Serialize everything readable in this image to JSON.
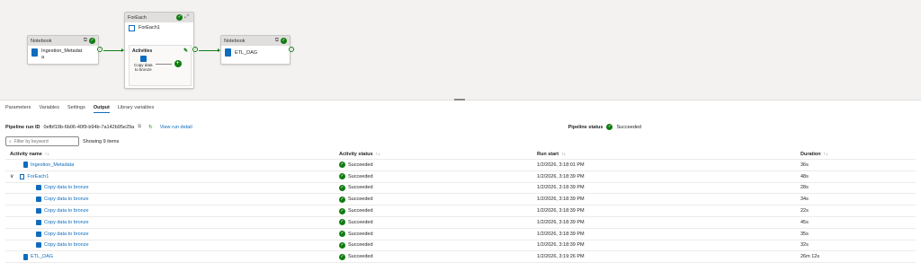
{
  "canvas": {
    "notebook1": {
      "header": "Notebook",
      "name_line1": "Ingestion_Metadat",
      "name_line2": "a"
    },
    "foreach": {
      "header": "ForEach",
      "name": "ForEach1",
      "activities_label": "Activities",
      "inner_line1": "Copy data",
      "inner_line2": "to bronze"
    },
    "notebook2": {
      "header": "Notebook",
      "name": "ETL_DAG"
    }
  },
  "tabs": [
    {
      "label": "Parameters"
    },
    {
      "label": "Variables"
    },
    {
      "label": "Settings"
    },
    {
      "label": "Output"
    },
    {
      "label": "Library variables"
    }
  ],
  "run": {
    "id_label": "Pipeline run ID",
    "id_value": "0efbf19b-6b06-40f9-b94b-7a142b95e29a",
    "view_detail": "View run detail",
    "status_label": "Pipeline status",
    "status_value": "Succeeded"
  },
  "filter": {
    "placeholder": "Filter by keyword",
    "showing": "Showing 9 items"
  },
  "columns": {
    "name": "Activity name",
    "status": "Activity status",
    "start": "Run start",
    "duration": "Duration"
  },
  "rows": [
    {
      "name": "Ingestion_Metadata",
      "status": "Succeeded",
      "start": "1/2/2026, 3:18:01 PM",
      "duration": "36s"
    },
    {
      "name": "ForEach1",
      "status": "Succeeded",
      "start": "1/2/2026, 3:18:39 PM",
      "duration": "48s"
    },
    {
      "name": "Copy data to bronze",
      "status": "Succeeded",
      "start": "1/2/2026, 3:18:39 PM",
      "duration": "28s"
    },
    {
      "name": "Copy data to bronze",
      "status": "Succeeded",
      "start": "1/2/2026, 3:18:39 PM",
      "duration": "34s"
    },
    {
      "name": "Copy data to bronze",
      "status": "Succeeded",
      "start": "1/2/2026, 3:18:39 PM",
      "duration": "22s"
    },
    {
      "name": "Copy data to bronze",
      "status": "Succeeded",
      "start": "1/2/2026, 3:18:39 PM",
      "duration": "45s"
    },
    {
      "name": "Copy data to bronze",
      "status": "Succeeded",
      "start": "1/2/2026, 3:18:39 PM",
      "duration": "35s"
    },
    {
      "name": "Copy data to bronze",
      "status": "Succeeded",
      "start": "1/2/2026, 3:18:39 PM",
      "duration": "32s"
    },
    {
      "name": "ETL_DAG",
      "status": "Succeeded",
      "start": "1/2/2026, 3:19:26 PM",
      "duration": "26m 12s"
    }
  ],
  "colors": {
    "accent": "#0f6cbd",
    "success": "#107c10",
    "canvas_bg": "#f3f2f1"
  }
}
